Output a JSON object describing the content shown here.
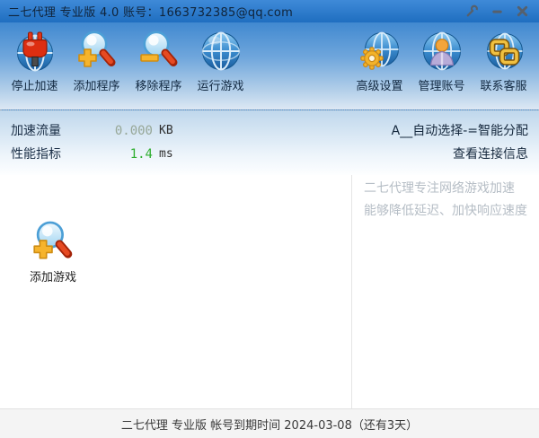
{
  "title_bar": {
    "title": "二七代理 专业版 4.0 账号：1663732385@qq.com"
  },
  "toolbar": {
    "left_buttons": [
      {
        "label": "停止加速",
        "icon": "stop-acceleration-icon"
      },
      {
        "label": "添加程序",
        "icon": "add-program-icon"
      },
      {
        "label": "移除程序",
        "icon": "remove-program-icon"
      },
      {
        "label": "运行游戏",
        "icon": "run-game-icon"
      }
    ],
    "right_buttons": [
      {
        "label": "高级设置",
        "icon": "advanced-settings-icon"
      },
      {
        "label": "管理账号",
        "icon": "manage-account-icon"
      },
      {
        "label": "联系客服",
        "icon": "contact-support-icon"
      }
    ]
  },
  "metrics": {
    "rows": [
      {
        "label": "加速流量",
        "value": "0.000",
        "unit": "KB",
        "value_color": "#97a797"
      },
      {
        "label": "性能指标",
        "value": "1.4",
        "unit": "ms",
        "value_color": "#2fae2f"
      }
    ]
  },
  "connection": {
    "server_line": "A__自动选择-=智能分配",
    "view_link": "查看连接信息"
  },
  "main": {
    "add_game_label": "添加游戏",
    "promo_line1": "二七代理专注网络游戏加速",
    "promo_line2": "能够降低延迟、加快响应速度"
  },
  "status_bar": {
    "text": "二七代理 专业版 帐号到期时间 2024-03-08（还有3天）"
  },
  "colors": {
    "titlebar_blue": "#2579cc",
    "toolbar_top": "#4189d0",
    "toolbar_bottom": "#dde8f4",
    "info_top": "#bfd7ec",
    "promo_gray": "#b5bdc5",
    "traffic_value": "#97a797",
    "ping_value": "#2fae2f"
  }
}
